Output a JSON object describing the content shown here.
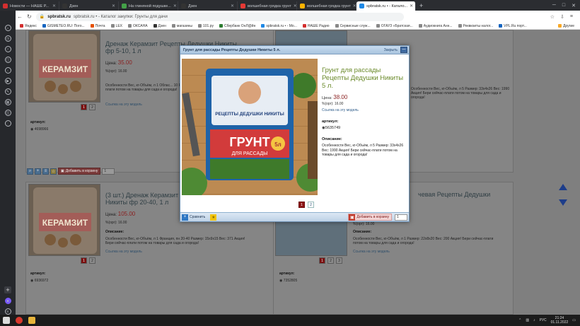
{
  "browser": {
    "tabs": [
      {
        "label": "Новости — НАШЕ Р...",
        "color": "#d32f2f",
        "active": false
      },
      {
        "label": "Дзен",
        "color": "#333333",
        "active": false
      },
      {
        "label": "На глиняной подушке...",
        "color": "#43a047",
        "active": false
      },
      {
        "label": "Дзен",
        "color": "#333333",
        "active": false
      },
      {
        "label": "волшебная грядка грунт",
        "color": "#e53935",
        "active": false
      },
      {
        "label": "волшебная грядка грунт",
        "color": "#ffb300",
        "active": false
      },
      {
        "label": "spbratsk.ru • - Катало...",
        "color": "#1e88e5",
        "active": true
      }
    ],
    "url_host": "spbratsk.ru",
    "url_title": "spbratsk.ru • - Каталог закупки: Грунты для дачи",
    "bookmarks": [
      "Яндекс",
      "GISMETEO.RU: Пого...",
      "Почта",
      "LEX",
      "ОКСАНА",
      "Дзен",
      "магазины",
      "101.ру",
      "Сбербанк ОнЛ@йн",
      "spbratsk.ru • - Мо...",
      "НАШЕ Радио",
      "Сервисные служ...",
      "ОГАУЗ «Братская...",
      "Аудиокнига Анн...",
      "Реквизиты налог...",
      "VPL.Ru порт..."
    ],
    "other_bookmarks": "Другие"
  },
  "catalog": {
    "cards": [
      {
        "title": "Дренаж Керамзит Рецепты Дедушки Никиты фр 5-10, 1 л",
        "price_label": "Цена:",
        "price": "35.00",
        "unit": "%(орг): 16.00",
        "link": "Ссылка на эту модель",
        "sku_label": "артикул:",
        "sku": "4698966",
        "pages": [
          "1",
          "2"
        ]
      },
      {
        "title": "(3 шт.) Дренаж Керамзит Рецепты Дедушки Никиты фр 20-40, 1 л",
        "price_label": "Цена:",
        "price": "105.00",
        "unit": "%(орг): 16.00",
        "desc_label": "Описание:",
        "desc": "Особенности Вес, кг-Объём, л 1 Франция, пн 20-40 Размер: 15x9x15 Вес: 371 Акция! Бери сейчас-плати потом на товары для сада и огорода!",
        "link": "Ссылка на эту модель",
        "sku_label": "артикул:",
        "sku": "6936972",
        "pages": [
          "1",
          "2"
        ]
      },
      {
        "right_text": "Особенности Вес, кг-Объём, л 5 Размер: 33x4x26 Вес: 1990 Акция! Бери сейчас-плати потом на товары для сада и огорода!",
        "sku_label": "артикул:",
        "sku": "7352805",
        "desc_label": "Описание:",
        "desc": "Особенности Вес, кг-Объём, л 1 Размер: 22x8x20 Вес: 200 Акция! Бери сейчас-плати потом на товары для сада и огорода!",
        "title": "чевая Рецепты Дедушки",
        "link": "Ссылка на эту модель",
        "unit": "%(орг): 16.00",
        "pages": [
          "1",
          "2",
          "3"
        ]
      }
    ],
    "left_desc": "Особенности Вес, кг-Объём, л 1 Облас... 10 Размер: 16x4x17 Вес: 410 Акция! Бери сейчас-плати потом на товары для сада и огорода!",
    "cart_label": "Добавить в корзину",
    "qty": "1"
  },
  "modal": {
    "header_title": "Грунт для рассады Рецепты Дедушки Никиты 5 л.",
    "close_text": "Закрыть",
    "product_name": "Грунт для рассады Рецепты Дедушки Никиты 5 л.",
    "price_label": "Цена:",
    "price": "38.00",
    "unit": "%(орг): 16.00",
    "link": "Ссылка на эту модель",
    "sku_label": "артикул:",
    "sku": "5635749",
    "desc_label": "Описание:",
    "desc": "Особенности Вес, кг-Объём, л 5 Размер: 33x4x26 Вес: 1990 Акция! Бери сейчас-плати потом на товары для сада и огорода!",
    "pages": [
      "1",
      "2"
    ],
    "compare_label": "Сравнить",
    "cart_label": "Добавить в корзину",
    "qty": "1",
    "package_text_top": "РЕЦЕПТЫ ДЕДУШКИ НИКИТЫ",
    "package_text_main": "ГРУНТ",
    "package_text_sub": "ДЛЯ РАССАДЫ",
    "package_volume": "5л",
    "package_small_keramzit": "КЕРАМЗИТ",
    "package_small_brand": "ЯРКИЕ ОЧКА"
  },
  "taskbar": {
    "time": "21:24",
    "date": "01.11.2022",
    "lang": "РУС"
  }
}
